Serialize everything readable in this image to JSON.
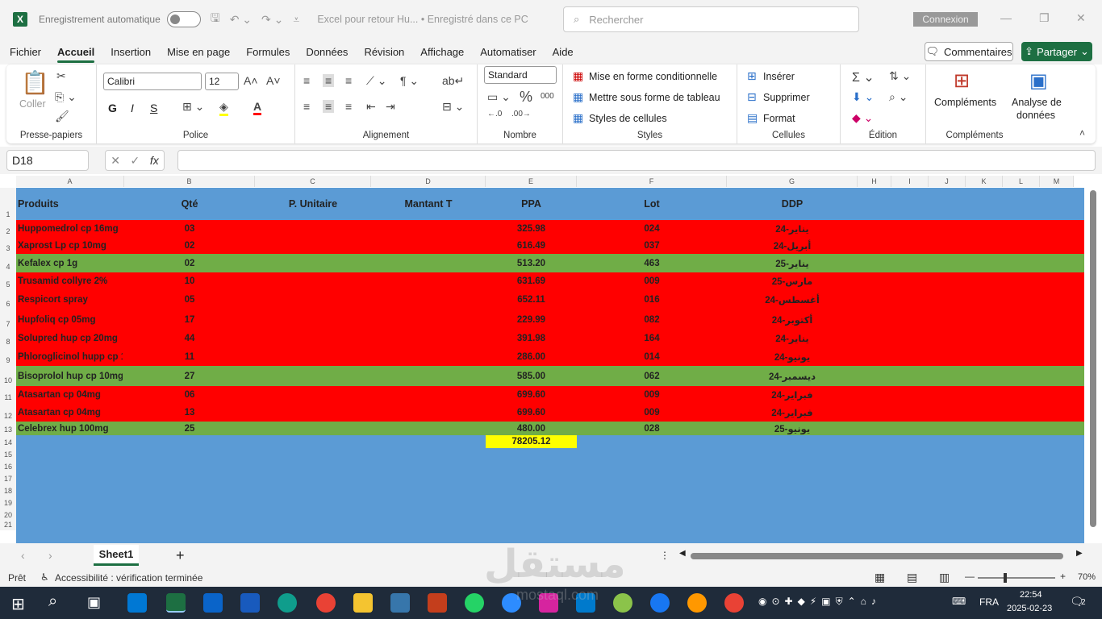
{
  "titlebar": {
    "autosave_label": "Enregistrement automatique",
    "doc_title": "Excel pour retour Hu...  •  Enregistré dans ce PC",
    "search_placeholder": "Rechercher",
    "connexion": "Connexion"
  },
  "menu": [
    "Fichier",
    "Accueil",
    "Insertion",
    "Mise en page",
    "Formules",
    "Données",
    "Révision",
    "Affichage",
    "Automatiser",
    "Aide"
  ],
  "menu_active": "Accueil",
  "actions": {
    "comments": "Commentaires",
    "share": "Partager"
  },
  "ribbon": {
    "clipboard": {
      "paste": "Coller",
      "label": "Presse-papiers"
    },
    "font": {
      "name": "Calibri",
      "size": "12",
      "bold": "G",
      "italic": "I",
      "underline": "S",
      "label": "Police"
    },
    "alignment": {
      "label": "Alignement"
    },
    "number": {
      "format": "Standard",
      "label": "Nombre"
    },
    "styles": {
      "cond": "Mise en forme conditionnelle",
      "table": "Mettre sous forme de tableau",
      "cell": "Styles de cellules",
      "label": "Styles"
    },
    "cells": {
      "insert": "Insérer",
      "delete": "Supprimer",
      "format": "Format",
      "label": "Cellules"
    },
    "editing": {
      "label": "Édition"
    },
    "addins": {
      "addins": "Compléments",
      "analyze1": "Analyse de",
      "analyze2": "données",
      "label": "Compléments"
    }
  },
  "namebox": "D18",
  "columns": [
    "A",
    "B",
    "C",
    "D",
    "E",
    "F",
    "G",
    "H",
    "I",
    "J",
    "K",
    "L",
    "M"
  ],
  "table": {
    "headers": [
      "Produits",
      "Qté",
      "P. Unitaire",
      "Mantant T",
      "PPA",
      "Lot",
      "DDP"
    ],
    "rows": [
      {
        "produit": "Huppomedrol cp 16mg",
        "qte": "03",
        "ppa": "325.98",
        "lot": "024",
        "ddp": "يناير-24",
        "status": "red"
      },
      {
        "produit": "Xaprost Lp cp 10mg",
        "qte": "02",
        "ppa": "616.49",
        "lot": "037",
        "ddp": "أبريل-24",
        "status": "red"
      },
      {
        "produit": "Kefalex cp 1g",
        "qte": "02",
        "ppa": "513.20",
        "lot": "463",
        "ddp": "يناير-25",
        "status": "green"
      },
      {
        "produit": "Trusamid collyre 2%",
        "qte": "10",
        "ppa": "631.69",
        "lot": "009",
        "ddp": "مارس-25",
        "status": "red"
      },
      {
        "produit": "Respicort spray",
        "qte": "05",
        "ppa": "652.11",
        "lot": "016",
        "ddp": "أغسطس-24",
        "status": "red"
      },
      {
        "produit": "Hupfoliq cp 05mg",
        "qte": "17",
        "ppa": "229.99",
        "lot": "082",
        "ddp": "أكتوبر-24",
        "status": "red"
      },
      {
        "produit": "Solupred hup cp 20mg",
        "qte": "44",
        "ppa": "391.98",
        "lot": "164",
        "ddp": "يناير-24",
        "status": "red"
      },
      {
        "produit": "Phloroglicinol hupp cp 1(",
        "qte": "11",
        "ppa": "286.00",
        "lot": "014",
        "ddp": "يونيو-24",
        "status": "red"
      },
      {
        "produit": "Bisoprolol hup cp 10mg",
        "qte": "27",
        "ppa": "585.00",
        "lot": "062",
        "ddp": "ديسمبر-24",
        "status": "green"
      },
      {
        "produit": "Atasartan cp 04mg",
        "qte": "06",
        "ppa": "699.60",
        "lot": "009",
        "ddp": "فبراير-24",
        "status": "red"
      },
      {
        "produit": "Atasartan cp 04mg",
        "qte": "13",
        "ppa": "699.60",
        "lot": "009",
        "ddp": "فبراير-24",
        "status": "red"
      },
      {
        "produit": "Celebrex hup 100mg",
        "qte": "25",
        "ppa": "480.00",
        "lot": "028",
        "ddp": "يونيو-25",
        "status": "green"
      }
    ],
    "total": "78205.12"
  },
  "colors": {
    "blue": "#5b9bd5",
    "red": "#ff0000",
    "green": "#70ad47",
    "yellow": "#ffff00",
    "excel": "#1d6f42"
  },
  "sheet_tab": "Sheet1",
  "status": {
    "ready": "Prêt",
    "accessibility": "Accessibilité : vérification terminée",
    "zoom": "70%"
  },
  "taskbar": {
    "lang": "FRA",
    "time": "22:54",
    "date": "2025-02-23",
    "notif": "2"
  },
  "watermark": {
    "ar": "مستقل",
    "latin": "mostaql.com"
  }
}
